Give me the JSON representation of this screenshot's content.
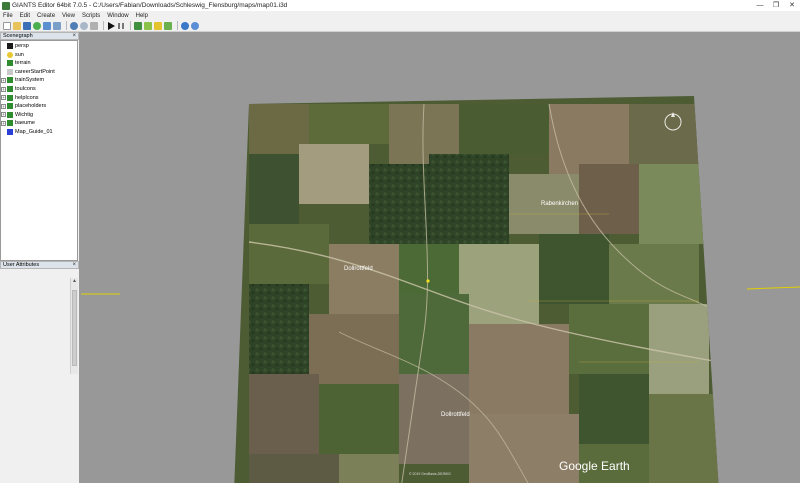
{
  "window": {
    "title": "GIANTS Editor 64bit 7.0.5 - C:/Users/Fabian/Downloads/Schleswig_Flensburg/maps/map01.i3d",
    "controls": {
      "minimize": "—",
      "maximize": "❐",
      "close": "✕"
    }
  },
  "menu": [
    "File",
    "Edit",
    "Create",
    "View",
    "Scripts",
    "Window",
    "Help"
  ],
  "toolbar": {
    "icons": [
      "new-file-icon",
      "open-folder-icon",
      "save-icon",
      "reload-icon",
      "save-as-icon",
      "export-icon",
      "undo-icon",
      "redo-icon",
      "cut-icon",
      "play-icon",
      "pause-icon",
      "terrain-paint-icon",
      "foliage-paint-icon",
      "select-icon",
      "height-icon",
      "globe-icon",
      "settings-icon"
    ]
  },
  "scenegraph": {
    "title": "Scenegraph",
    "nodes": [
      {
        "label": "persp",
        "icon": "camera-icon",
        "expandable": false,
        "color": "#1a1a1a"
      },
      {
        "label": "sun",
        "icon": "light-bulb-icon",
        "expandable": false,
        "color": "#e8c832"
      },
      {
        "label": "terrain",
        "icon": "terrain-icon",
        "expandable": false,
        "color": "#2e8b2e"
      },
      {
        "label": "careerStartPoint",
        "icon": "transform-group-icon",
        "expandable": false,
        "color": "#c8c8c8"
      },
      {
        "label": "trainSystem",
        "icon": "transform-group-icon",
        "expandable": true,
        "color": "#2e8b2e"
      },
      {
        "label": "touIcons",
        "icon": "transform-group-icon",
        "expandable": true,
        "color": "#2e8b2e"
      },
      {
        "label": "helpIcons",
        "icon": "transform-group-icon",
        "expandable": true,
        "color": "#2e8b2e"
      },
      {
        "label": "placeholders",
        "icon": "transform-group-icon",
        "expandable": true,
        "color": "#2e8b2e"
      },
      {
        "label": "Wichtig",
        "icon": "transform-group-icon",
        "expandable": true,
        "color": "#2e8b2e"
      },
      {
        "label": "baeume",
        "icon": "transform-group-icon",
        "expandable": true,
        "color": "#2e8b2e"
      },
      {
        "label": "Map_Guide_01",
        "icon": "shape-cube-icon",
        "expandable": false,
        "color": "#2b3fd6"
      }
    ]
  },
  "attributes": {
    "title": "User Attributes"
  },
  "map": {
    "labels": [
      {
        "text": "Rabenkirchen"
      },
      {
        "text": "Dollrottfeld"
      },
      {
        "text": "Dollrottfeld"
      }
    ],
    "watermark": "Google Earth",
    "credit": "© 2019 GeoBasis-DE/BKG"
  },
  "colors": {
    "viewport_bg": "#989898",
    "field_green": "#5a6b3a",
    "forest": "#2f4426",
    "locator_line": "#e0d000"
  }
}
